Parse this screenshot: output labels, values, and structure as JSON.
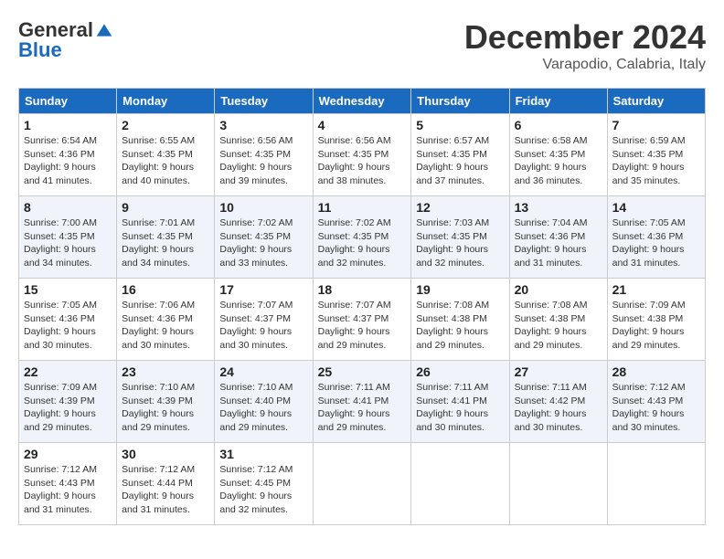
{
  "logo": {
    "general": "General",
    "blue": "Blue"
  },
  "title": "December 2024",
  "location": "Varapodio, Calabria, Italy",
  "weekdays": [
    "Sunday",
    "Monday",
    "Tuesday",
    "Wednesday",
    "Thursday",
    "Friday",
    "Saturday"
  ],
  "weeks": [
    [
      {
        "day": "1",
        "sunrise": "6:54 AM",
        "sunset": "4:36 PM",
        "daylight": "9 hours and 41 minutes."
      },
      {
        "day": "2",
        "sunrise": "6:55 AM",
        "sunset": "4:35 PM",
        "daylight": "9 hours and 40 minutes."
      },
      {
        "day": "3",
        "sunrise": "6:56 AM",
        "sunset": "4:35 PM",
        "daylight": "9 hours and 39 minutes."
      },
      {
        "day": "4",
        "sunrise": "6:56 AM",
        "sunset": "4:35 PM",
        "daylight": "9 hours and 38 minutes."
      },
      {
        "day": "5",
        "sunrise": "6:57 AM",
        "sunset": "4:35 PM",
        "daylight": "9 hours and 37 minutes."
      },
      {
        "day": "6",
        "sunrise": "6:58 AM",
        "sunset": "4:35 PM",
        "daylight": "9 hours and 36 minutes."
      },
      {
        "day": "7",
        "sunrise": "6:59 AM",
        "sunset": "4:35 PM",
        "daylight": "9 hours and 35 minutes."
      }
    ],
    [
      {
        "day": "8",
        "sunrise": "7:00 AM",
        "sunset": "4:35 PM",
        "daylight": "9 hours and 34 minutes."
      },
      {
        "day": "9",
        "sunrise": "7:01 AM",
        "sunset": "4:35 PM",
        "daylight": "9 hours and 34 minutes."
      },
      {
        "day": "10",
        "sunrise": "7:02 AM",
        "sunset": "4:35 PM",
        "daylight": "9 hours and 33 minutes."
      },
      {
        "day": "11",
        "sunrise": "7:02 AM",
        "sunset": "4:35 PM",
        "daylight": "9 hours and 32 minutes."
      },
      {
        "day": "12",
        "sunrise": "7:03 AM",
        "sunset": "4:35 PM",
        "daylight": "9 hours and 32 minutes."
      },
      {
        "day": "13",
        "sunrise": "7:04 AM",
        "sunset": "4:36 PM",
        "daylight": "9 hours and 31 minutes."
      },
      {
        "day": "14",
        "sunrise": "7:05 AM",
        "sunset": "4:36 PM",
        "daylight": "9 hours and 31 minutes."
      }
    ],
    [
      {
        "day": "15",
        "sunrise": "7:05 AM",
        "sunset": "4:36 PM",
        "daylight": "9 hours and 30 minutes."
      },
      {
        "day": "16",
        "sunrise": "7:06 AM",
        "sunset": "4:36 PM",
        "daylight": "9 hours and 30 minutes."
      },
      {
        "day": "17",
        "sunrise": "7:07 AM",
        "sunset": "4:37 PM",
        "daylight": "9 hours and 30 minutes."
      },
      {
        "day": "18",
        "sunrise": "7:07 AM",
        "sunset": "4:37 PM",
        "daylight": "9 hours and 29 minutes."
      },
      {
        "day": "19",
        "sunrise": "7:08 AM",
        "sunset": "4:38 PM",
        "daylight": "9 hours and 29 minutes."
      },
      {
        "day": "20",
        "sunrise": "7:08 AM",
        "sunset": "4:38 PM",
        "daylight": "9 hours and 29 minutes."
      },
      {
        "day": "21",
        "sunrise": "7:09 AM",
        "sunset": "4:38 PM",
        "daylight": "9 hours and 29 minutes."
      }
    ],
    [
      {
        "day": "22",
        "sunrise": "7:09 AM",
        "sunset": "4:39 PM",
        "daylight": "9 hours and 29 minutes."
      },
      {
        "day": "23",
        "sunrise": "7:10 AM",
        "sunset": "4:39 PM",
        "daylight": "9 hours and 29 minutes."
      },
      {
        "day": "24",
        "sunrise": "7:10 AM",
        "sunset": "4:40 PM",
        "daylight": "9 hours and 29 minutes."
      },
      {
        "day": "25",
        "sunrise": "7:11 AM",
        "sunset": "4:41 PM",
        "daylight": "9 hours and 29 minutes."
      },
      {
        "day": "26",
        "sunrise": "7:11 AM",
        "sunset": "4:41 PM",
        "daylight": "9 hours and 30 minutes."
      },
      {
        "day": "27",
        "sunrise": "7:11 AM",
        "sunset": "4:42 PM",
        "daylight": "9 hours and 30 minutes."
      },
      {
        "day": "28",
        "sunrise": "7:12 AM",
        "sunset": "4:43 PM",
        "daylight": "9 hours and 30 minutes."
      }
    ],
    [
      {
        "day": "29",
        "sunrise": "7:12 AM",
        "sunset": "4:43 PM",
        "daylight": "9 hours and 31 minutes."
      },
      {
        "day": "30",
        "sunrise": "7:12 AM",
        "sunset": "4:44 PM",
        "daylight": "9 hours and 31 minutes."
      },
      {
        "day": "31",
        "sunrise": "7:12 AM",
        "sunset": "4:45 PM",
        "daylight": "9 hours and 32 minutes."
      },
      null,
      null,
      null,
      null
    ]
  ]
}
